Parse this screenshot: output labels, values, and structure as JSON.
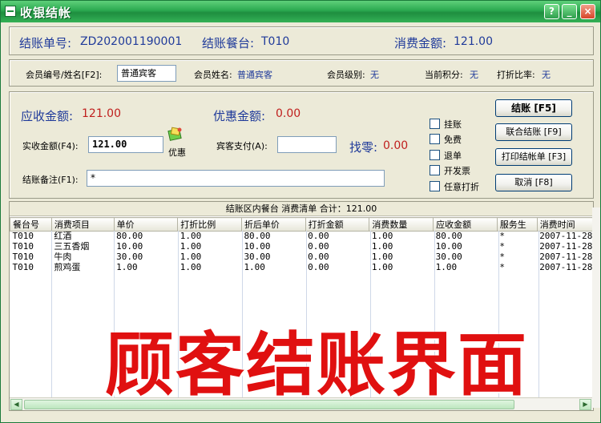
{
  "window": {
    "title": "收银结帐",
    "help": "?",
    "minimize": "_",
    "close": "×"
  },
  "bill": {
    "no_label": "结账单号:",
    "no_value": "ZD202001190001",
    "table_label": "结账餐台:",
    "table_value": "T010",
    "total_label": "消费金额:",
    "total_value": "121.00"
  },
  "member": {
    "id_label": "会员编号/姓名[F2]:",
    "id_value": "普通宾客",
    "name_label": "会员姓名:",
    "name_value": "普通宾客",
    "level_label": "会员级别:",
    "level_value": "无",
    "points_label": "当前积分:",
    "points_value": "无",
    "discount_label": "打折比率:",
    "discount_value": "无"
  },
  "payment": {
    "receivable_label": "应收金额:",
    "receivable_value": "121.00",
    "discount_label": "优惠金额:",
    "discount_value": "0.00",
    "paid_label": "实收金额(F4):",
    "paid_value": "121.00",
    "coupon_label": "优惠",
    "guest_label": "宾客支付(A):",
    "guest_value": "",
    "change_label": "找零:",
    "change_value": "0.00",
    "remark_label": "结账备注(F1):",
    "remark_value": "*"
  },
  "options": [
    "挂账",
    "免费",
    "退单",
    "开发票",
    "任意打折"
  ],
  "buttons": {
    "checkout": "结账 [F5]",
    "joint": "联合结账 [F9]",
    "print": "打印结帐单 [F3]",
    "cancel": "取消 [F8]"
  },
  "grid": {
    "header_text": "结账区内餐台  消费清单  合计：121.00",
    "columns": [
      "餐台号",
      "消费项目",
      "单价",
      "打折比例",
      "折后单价",
      "打折金额",
      "消费数量",
      "应收金额",
      "服务生",
      "消费时间"
    ],
    "rows": [
      [
        "T010",
        "红酒",
        "80.00",
        "1.00",
        "80.00",
        "0.00",
        "1.00",
        "80.00",
        "*",
        "2007-11-28"
      ],
      [
        "T010",
        "三五香烟",
        "10.00",
        "1.00",
        "10.00",
        "0.00",
        "1.00",
        "10.00",
        "*",
        "2007-11-28"
      ],
      [
        "T010",
        "牛肉",
        "30.00",
        "1.00",
        "30.00",
        "0.00",
        "1.00",
        "30.00",
        "*",
        "2007-11-28"
      ],
      [
        "T010",
        "煎鸡蛋",
        "1.00",
        "1.00",
        "1.00",
        "0.00",
        "1.00",
        "1.00",
        "*",
        "2007-11-28"
      ]
    ]
  },
  "overlay_caption": "顾客结账界面",
  "colors": {
    "titlebar": "#2aa84f",
    "label_blue": "#1f3a9a",
    "value_red": "#c0201e",
    "caption_red": "#e01010"
  }
}
